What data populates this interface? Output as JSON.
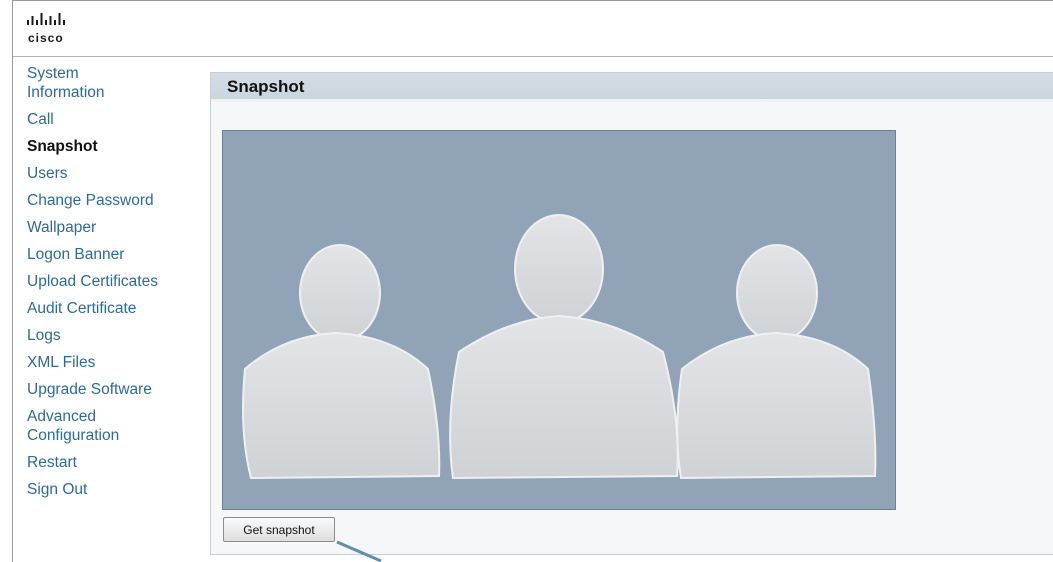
{
  "brand": {
    "logo_text": "cisco",
    "logo_icon": "cisco-bridge-icon"
  },
  "sidebar": {
    "items": [
      {
        "label": "System Information",
        "active": false
      },
      {
        "label": "Call",
        "active": false
      },
      {
        "label": "Snapshot",
        "active": true
      },
      {
        "label": "Users",
        "active": false
      },
      {
        "label": "Change Password",
        "active": false
      },
      {
        "label": "Wallpaper",
        "active": false
      },
      {
        "label": "Logon Banner",
        "active": false
      },
      {
        "label": "Upload Certificates",
        "active": false
      },
      {
        "label": "Audit Certificate",
        "active": false
      },
      {
        "label": "Logs",
        "active": false
      },
      {
        "label": "XML Files",
        "active": false
      },
      {
        "label": "Upgrade Software",
        "active": false
      },
      {
        "label": "Advanced Configuration",
        "active": false
      },
      {
        "label": "Restart",
        "active": false
      },
      {
        "label": "Sign Out",
        "active": false
      }
    ]
  },
  "panel": {
    "title": "Snapshot",
    "get_snapshot_label": "Get snapshot",
    "placeholder_icon": "three-people-silhouette-icon"
  },
  "colors": {
    "link": "#2d6a9c",
    "header_bar": "#cbd5df",
    "snapshot_bg": "#91a4b7",
    "silhouette": "#d6d8db",
    "pointer": "#5f8fb0"
  }
}
